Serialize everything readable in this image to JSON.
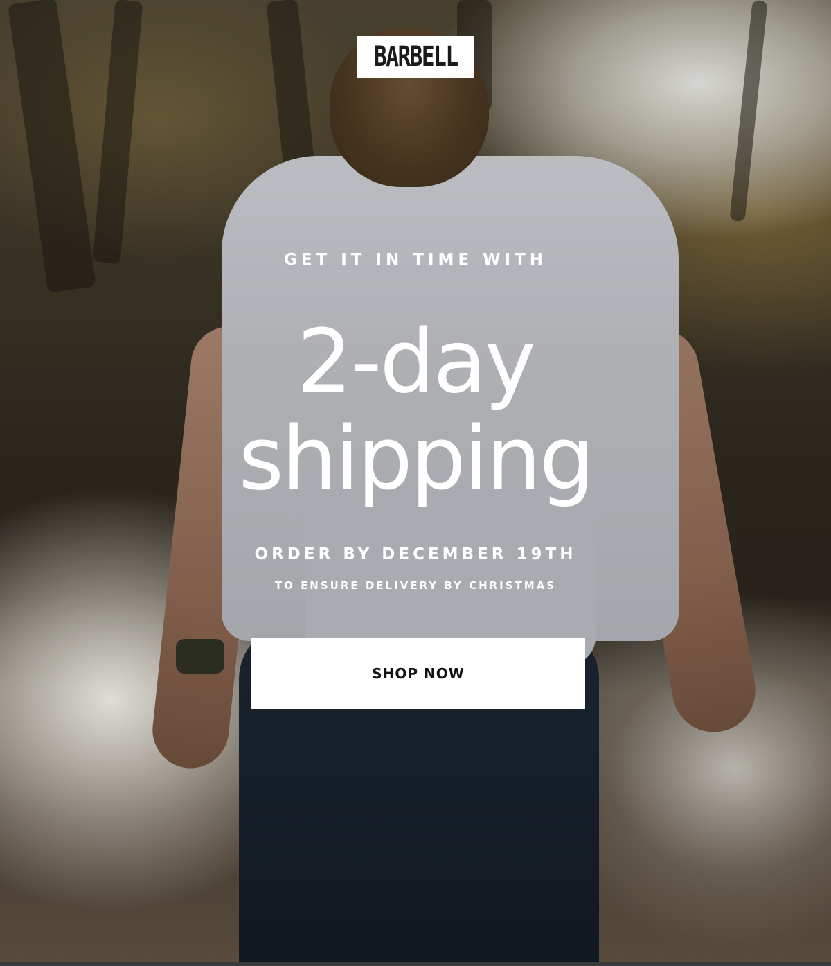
{
  "brand": {
    "logo_text": "BARBELL"
  },
  "hero": {
    "image_alt": "Man in a light grey t-shirt and dark jeans walking toward a creek in an autumn forest",
    "eyebrow": "GET IT IN TIME WITH",
    "headline_line1": "2-day",
    "headline_line2": "shipping",
    "order_by": "ORDER BY DECEMBER 19TH",
    "ensure_delivery": "TO ENSURE DELIVERY BY CHRISTMAS"
  },
  "cta": {
    "label": "SHOP NOW"
  },
  "colors": {
    "text": "#ffffff",
    "button_bg": "#ffffff",
    "button_text": "#111111",
    "logo_bg": "#ffffff",
    "logo_text": "#1a1a1a"
  }
}
